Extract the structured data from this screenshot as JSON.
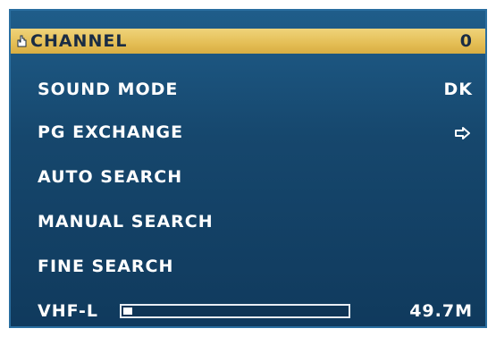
{
  "menu": {
    "items": [
      {
        "label": "CHANNEL",
        "value": "0",
        "selected": true
      },
      {
        "label": "SOUND MODE",
        "value": "DK"
      },
      {
        "label": "PG EXCHANGE",
        "value": "",
        "icon": "right-arrow-icon"
      },
      {
        "label": "AUTO SEARCH",
        "value": ""
      },
      {
        "label": "MANUAL SEARCH",
        "value": ""
      },
      {
        "label": "FINE SEARCH",
        "value": ""
      }
    ],
    "band": {
      "label": "VHF-L",
      "frequency": "49.7M",
      "level_fraction": 0.04
    },
    "selected_icon": "hand-pointer-icon"
  },
  "colors": {
    "background": "#16476d",
    "highlight": "#e4be55",
    "text": "#ffffff",
    "highlight_text": "#1a2c44"
  }
}
